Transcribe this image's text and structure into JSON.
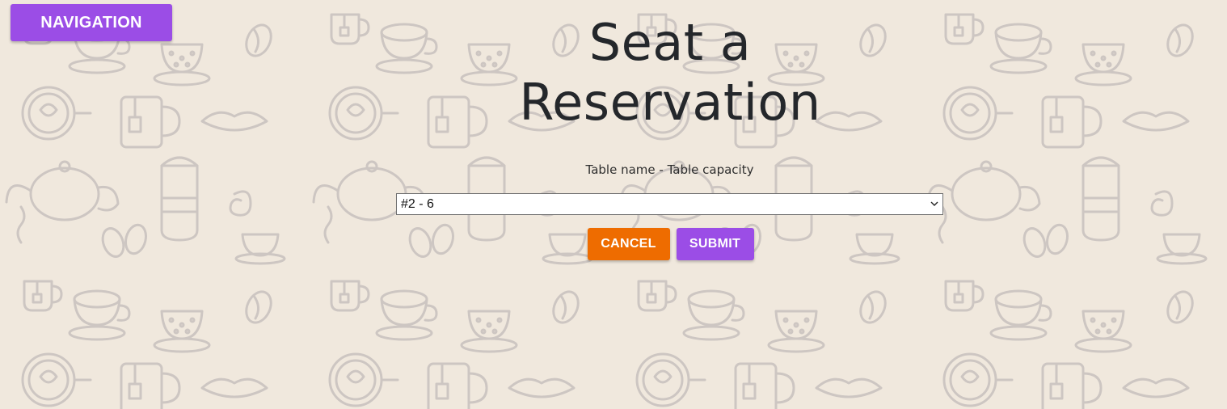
{
  "colors": {
    "background": "#f0e8dd",
    "pattern": "#cdc6c2",
    "nav_button": "#9b4de6",
    "cancel_button": "#ee6c00",
    "submit_button": "#9b4de6",
    "title_text": "#24272b"
  },
  "nav": {
    "label": "NAVIGATION"
  },
  "page": {
    "title_line1": "Seat a",
    "title_line2": "Reservation"
  },
  "form": {
    "table_label": "Table name - Table capacity",
    "table_select_value": "#2 - 6",
    "cancel_label": "CANCEL",
    "submit_label": "SUBMIT"
  },
  "icons": {
    "background_pattern": "coffee-doodle-pattern",
    "select_arrow": "chevron-down-icon"
  }
}
